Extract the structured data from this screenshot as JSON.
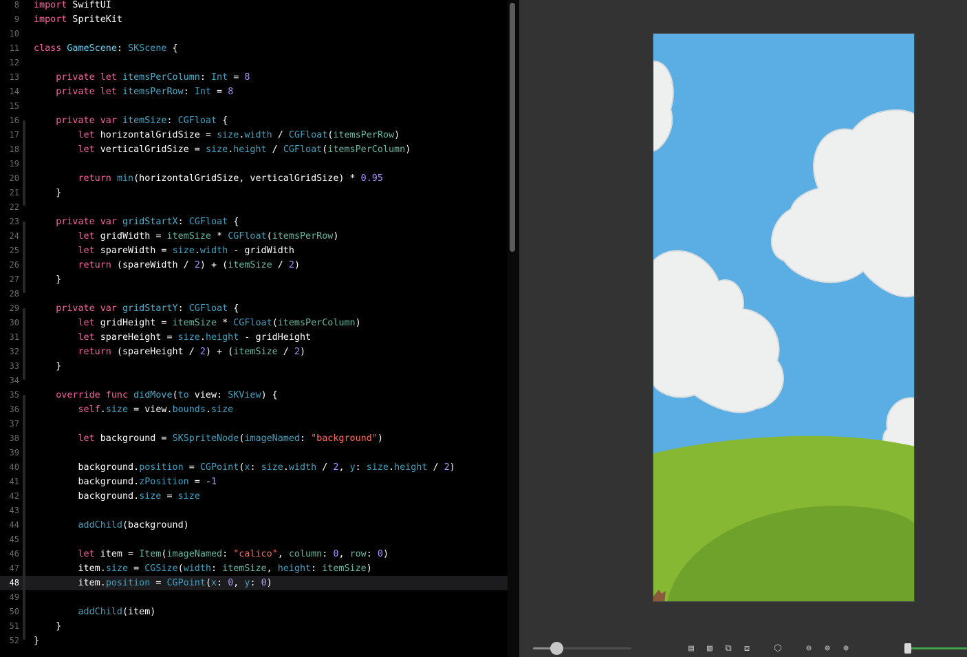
{
  "editor": {
    "current_line": 48,
    "lines": [
      {
        "n": "8",
        "t": [
          [
            "kw",
            "import"
          ],
          [
            "nm",
            " SwiftUI"
          ]
        ]
      },
      {
        "n": "9",
        "t": [
          [
            "kw",
            "import"
          ],
          [
            "nm",
            " SpriteKit"
          ]
        ]
      },
      {
        "n": "10",
        "t": []
      },
      {
        "n": "11",
        "t": [
          [
            "kw",
            "class"
          ],
          [
            "nm",
            " "
          ],
          [
            "ty2",
            "GameScene"
          ],
          [
            "nm",
            ": "
          ],
          [
            "tyd",
            "SKScene"
          ],
          [
            "nm",
            " {"
          ]
        ]
      },
      {
        "n": "12",
        "t": []
      },
      {
        "n": "13",
        "t": [
          [
            "nm",
            "    "
          ],
          [
            "kw",
            "private let"
          ],
          [
            "nm",
            " "
          ],
          [
            "pn",
            "itemsPerColumn"
          ],
          [
            "nm",
            ": "
          ],
          [
            "tyd",
            "Int"
          ],
          [
            "nm",
            " = "
          ],
          [
            "num2",
            "8"
          ]
        ]
      },
      {
        "n": "14",
        "t": [
          [
            "nm",
            "    "
          ],
          [
            "kw",
            "private let"
          ],
          [
            "nm",
            " "
          ],
          [
            "pn",
            "itemsPerRow"
          ],
          [
            "nm",
            ": "
          ],
          [
            "tyd",
            "Int"
          ],
          [
            "nm",
            " = "
          ],
          [
            "num2",
            "8"
          ]
        ]
      },
      {
        "n": "15",
        "t": []
      },
      {
        "n": "16",
        "t": [
          [
            "nm",
            "    "
          ],
          [
            "kw",
            "private var"
          ],
          [
            "nm",
            " "
          ],
          [
            "pn",
            "itemSize"
          ],
          [
            "nm",
            ": "
          ],
          [
            "tyd",
            "CGFloat"
          ],
          [
            "nm",
            " {"
          ]
        ]
      },
      {
        "n": "17",
        "t": [
          [
            "nm",
            "        "
          ],
          [
            "kw",
            "let"
          ],
          [
            "nm",
            " horizontalGridSize = "
          ],
          [
            "tyd",
            "size"
          ],
          [
            "nm",
            "."
          ],
          [
            "tyd",
            "width"
          ],
          [
            "nm",
            " / "
          ],
          [
            "tyd",
            "CGFloat"
          ],
          [
            "nm",
            "("
          ],
          [
            "grn",
            "itemsPerRow"
          ],
          [
            "nm",
            ")"
          ]
        ]
      },
      {
        "n": "18",
        "t": [
          [
            "nm",
            "        "
          ],
          [
            "kw",
            "let"
          ],
          [
            "nm",
            " verticalGridSize = "
          ],
          [
            "tyd",
            "size"
          ],
          [
            "nm",
            "."
          ],
          [
            "tyd",
            "height"
          ],
          [
            "nm",
            " / "
          ],
          [
            "tyd",
            "CGFloat"
          ],
          [
            "nm",
            "("
          ],
          [
            "grn",
            "itemsPerColumn"
          ],
          [
            "nm",
            ")"
          ]
        ]
      },
      {
        "n": "19",
        "t": []
      },
      {
        "n": "20",
        "t": [
          [
            "nm",
            "        "
          ],
          [
            "kw",
            "return"
          ],
          [
            "nm",
            " "
          ],
          [
            "tyd",
            "min"
          ],
          [
            "nm",
            "(horizontalGridSize, verticalGridSize) * "
          ],
          [
            "num2",
            "0.95"
          ]
        ]
      },
      {
        "n": "21",
        "t": [
          [
            "nm",
            "    }"
          ]
        ]
      },
      {
        "n": "22",
        "t": []
      },
      {
        "n": "23",
        "t": [
          [
            "nm",
            "    "
          ],
          [
            "kw",
            "private var"
          ],
          [
            "nm",
            " "
          ],
          [
            "pn",
            "gridStartX"
          ],
          [
            "nm",
            ": "
          ],
          [
            "tyd",
            "CGFloat"
          ],
          [
            "nm",
            " {"
          ]
        ]
      },
      {
        "n": "24",
        "t": [
          [
            "nm",
            "        "
          ],
          [
            "kw",
            "let"
          ],
          [
            "nm",
            " gridWidth = "
          ],
          [
            "grn",
            "itemSize"
          ],
          [
            "nm",
            " * "
          ],
          [
            "tyd",
            "CGFloat"
          ],
          [
            "nm",
            "("
          ],
          [
            "grn",
            "itemsPerRow"
          ],
          [
            "nm",
            ")"
          ]
        ]
      },
      {
        "n": "25",
        "t": [
          [
            "nm",
            "        "
          ],
          [
            "kw",
            "let"
          ],
          [
            "nm",
            " spareWidth = "
          ],
          [
            "tyd",
            "size"
          ],
          [
            "nm",
            "."
          ],
          [
            "tyd",
            "width"
          ],
          [
            "nm",
            " - gridWidth"
          ]
        ]
      },
      {
        "n": "26",
        "t": [
          [
            "nm",
            "        "
          ],
          [
            "kw",
            "return"
          ],
          [
            "nm",
            " (spareWidth / "
          ],
          [
            "num2",
            "2"
          ],
          [
            "nm",
            ") + ("
          ],
          [
            "grn",
            "itemSize"
          ],
          [
            "nm",
            " / "
          ],
          [
            "num2",
            "2"
          ],
          [
            "nm",
            ")"
          ]
        ]
      },
      {
        "n": "27",
        "t": [
          [
            "nm",
            "    }"
          ]
        ]
      },
      {
        "n": "28",
        "t": []
      },
      {
        "n": "29",
        "t": [
          [
            "nm",
            "    "
          ],
          [
            "kw",
            "private var"
          ],
          [
            "nm",
            " "
          ],
          [
            "pn",
            "gridStartY"
          ],
          [
            "nm",
            ": "
          ],
          [
            "tyd",
            "CGFloat"
          ],
          [
            "nm",
            " {"
          ]
        ]
      },
      {
        "n": "30",
        "t": [
          [
            "nm",
            "        "
          ],
          [
            "kw",
            "let"
          ],
          [
            "nm",
            " gridHeight = "
          ],
          [
            "grn",
            "itemSize"
          ],
          [
            "nm",
            " * "
          ],
          [
            "tyd",
            "CGFloat"
          ],
          [
            "nm",
            "("
          ],
          [
            "grn",
            "itemsPerColumn"
          ],
          [
            "nm",
            ")"
          ]
        ]
      },
      {
        "n": "31",
        "t": [
          [
            "nm",
            "        "
          ],
          [
            "kw",
            "let"
          ],
          [
            "nm",
            " spareHeight = "
          ],
          [
            "tyd",
            "size"
          ],
          [
            "nm",
            "."
          ],
          [
            "tyd",
            "height"
          ],
          [
            "nm",
            " - gridHeight"
          ]
        ]
      },
      {
        "n": "32",
        "t": [
          [
            "nm",
            "        "
          ],
          [
            "kw",
            "return"
          ],
          [
            "nm",
            " (spareHeight / "
          ],
          [
            "num2",
            "2"
          ],
          [
            "nm",
            ") + ("
          ],
          [
            "grn",
            "itemSize"
          ],
          [
            "nm",
            " / "
          ],
          [
            "num2",
            "2"
          ],
          [
            "nm",
            ")"
          ]
        ]
      },
      {
        "n": "33",
        "t": [
          [
            "nm",
            "    }"
          ]
        ]
      },
      {
        "n": "34",
        "t": []
      },
      {
        "n": "35",
        "t": [
          [
            "nm",
            "    "
          ],
          [
            "kw",
            "override func"
          ],
          [
            "nm",
            " "
          ],
          [
            "pn",
            "didMove"
          ],
          [
            "nm",
            "("
          ],
          [
            "tyd",
            "to"
          ],
          [
            "nm",
            " view: "
          ],
          [
            "tyd",
            "SKView"
          ],
          [
            "nm",
            ") {"
          ]
        ]
      },
      {
        "n": "36",
        "t": [
          [
            "nm",
            "        "
          ],
          [
            "kw",
            "self"
          ],
          [
            "nm",
            "."
          ],
          [
            "tyd",
            "size"
          ],
          [
            "nm",
            " = view."
          ],
          [
            "tyd",
            "bounds"
          ],
          [
            "nm",
            "."
          ],
          [
            "tyd",
            "size"
          ]
        ]
      },
      {
        "n": "37",
        "t": []
      },
      {
        "n": "38",
        "t": [
          [
            "nm",
            "        "
          ],
          [
            "kw",
            "let"
          ],
          [
            "nm",
            " background = "
          ],
          [
            "tyd",
            "SKSpriteNode"
          ],
          [
            "nm",
            "("
          ],
          [
            "tyd",
            "imageNamed"
          ],
          [
            "nm",
            ": "
          ],
          [
            "str",
            "\"background\""
          ],
          [
            "nm",
            ")"
          ]
        ]
      },
      {
        "n": "39",
        "t": []
      },
      {
        "n": "40",
        "t": [
          [
            "nm",
            "        background."
          ],
          [
            "tyd",
            "position"
          ],
          [
            "nm",
            " = "
          ],
          [
            "tyd",
            "CGPoint"
          ],
          [
            "nm",
            "("
          ],
          [
            "tyd",
            "x"
          ],
          [
            "nm",
            ": "
          ],
          [
            "tyd",
            "size"
          ],
          [
            "nm",
            "."
          ],
          [
            "tyd",
            "width"
          ],
          [
            "nm",
            " / "
          ],
          [
            "num2",
            "2"
          ],
          [
            "nm",
            ", "
          ],
          [
            "tyd",
            "y"
          ],
          [
            "nm",
            ": "
          ],
          [
            "tyd",
            "size"
          ],
          [
            "nm",
            "."
          ],
          [
            "tyd",
            "height"
          ],
          [
            "nm",
            " / "
          ],
          [
            "num2",
            "2"
          ],
          [
            "nm",
            ")"
          ]
        ]
      },
      {
        "n": "41",
        "t": [
          [
            "nm",
            "        background."
          ],
          [
            "tyd",
            "zPosition"
          ],
          [
            "nm",
            " = -"
          ],
          [
            "num2",
            "1"
          ]
        ]
      },
      {
        "n": "42",
        "t": [
          [
            "nm",
            "        background."
          ],
          [
            "tyd",
            "size"
          ],
          [
            "nm",
            " = "
          ],
          [
            "tyd",
            "size"
          ]
        ]
      },
      {
        "n": "43",
        "t": []
      },
      {
        "n": "44",
        "t": [
          [
            "nm",
            "        "
          ],
          [
            "tyd",
            "addChild"
          ],
          [
            "nm",
            "(background)"
          ]
        ]
      },
      {
        "n": "45",
        "t": []
      },
      {
        "n": "46",
        "t": [
          [
            "nm",
            "        "
          ],
          [
            "kw",
            "let"
          ],
          [
            "nm",
            " item = "
          ],
          [
            "grn",
            "Item"
          ],
          [
            "nm",
            "("
          ],
          [
            "grn",
            "imageNamed"
          ],
          [
            "nm",
            ": "
          ],
          [
            "str",
            "\"calico\""
          ],
          [
            "nm",
            ", "
          ],
          [
            "grn",
            "column"
          ],
          [
            "nm",
            ": "
          ],
          [
            "num2",
            "0"
          ],
          [
            "nm",
            ", "
          ],
          [
            "grn",
            "row"
          ],
          [
            "nm",
            ": "
          ],
          [
            "num2",
            "0"
          ],
          [
            "nm",
            ")"
          ]
        ]
      },
      {
        "n": "47",
        "t": [
          [
            "nm",
            "        item."
          ],
          [
            "tyd",
            "size"
          ],
          [
            "nm",
            " = "
          ],
          [
            "tyd",
            "CGSize"
          ],
          [
            "nm",
            "("
          ],
          [
            "tyd",
            "width"
          ],
          [
            "nm",
            ": "
          ],
          [
            "grn",
            "itemSize"
          ],
          [
            "nm",
            ", "
          ],
          [
            "tyd",
            "height"
          ],
          [
            "nm",
            ": "
          ],
          [
            "grn",
            "itemSize"
          ],
          [
            "nm",
            ")"
          ]
        ]
      },
      {
        "n": "48",
        "t": [
          [
            "nm",
            "        item."
          ],
          [
            "tyd",
            "position"
          ],
          [
            "nm",
            " = "
          ],
          [
            "tyd",
            "CGPoint"
          ],
          [
            "nm",
            "("
          ],
          [
            "tyd",
            "x"
          ],
          [
            "nm",
            ": "
          ],
          [
            "num2",
            "0"
          ],
          [
            "nm",
            ", "
          ],
          [
            "tyd",
            "y"
          ],
          [
            "nm",
            ": "
          ],
          [
            "num2",
            "0"
          ],
          [
            "nm",
            ")"
          ]
        ]
      },
      {
        "n": "49",
        "t": []
      },
      {
        "n": "50",
        "t": [
          [
            "nm",
            "        "
          ],
          [
            "tyd",
            "addChild"
          ],
          [
            "nm",
            "(item)"
          ]
        ]
      },
      {
        "n": "51",
        "t": [
          [
            "nm",
            "    }"
          ]
        ]
      },
      {
        "n": "52",
        "t": [
          [
            "nm",
            "}"
          ]
        ]
      }
    ]
  },
  "colors": {
    "sky": "#5aaee3",
    "cloud": "#eef0f0",
    "grass_light": "#86b833",
    "grass_dark": "#6fa22a"
  },
  "preview": {
    "scene_slider_fraction": 0.24
  },
  "toolbar": {
    "icons": [
      "layout-top-icon",
      "layout-split-icon",
      "layout-overlap-icon",
      "layout-stack-icon",
      "cube-icon",
      "zoom-out-icon",
      "zoom-fit-icon",
      "zoom-in-icon"
    ]
  }
}
